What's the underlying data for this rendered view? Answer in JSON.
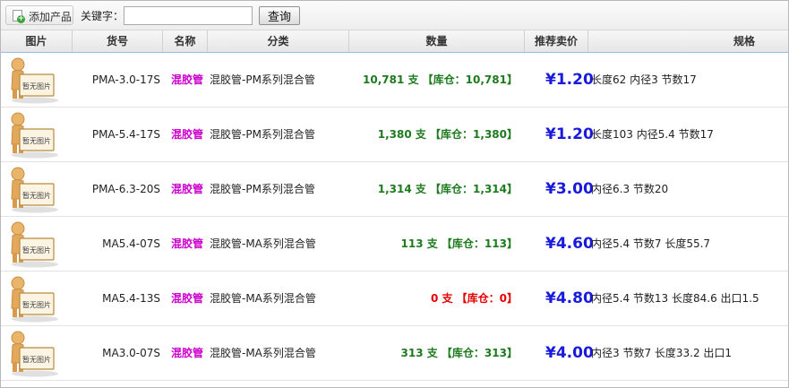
{
  "toolbar": {
    "add_label": "添加产品",
    "keyword_label": "关键字：",
    "keyword_value": "",
    "search_label": "查询"
  },
  "columns": {
    "image": "图片",
    "code": "货号",
    "name": "名称",
    "category": "分类",
    "quantity": "数量",
    "price": "推荐卖价",
    "spec": "规格"
  },
  "placeholder_image_text": "暂无图片",
  "colors": {
    "name": "#cc00cc",
    "qty_in_stock": "#1e7a1e",
    "qty_zero": "#e60000",
    "price": "#1a1adc",
    "header_border": "#99bbe8"
  },
  "rows": [
    {
      "code": "PMA-3.0-17S",
      "name": "混胶管",
      "category": "混胶管-PM系列混合管",
      "quantity": "10,781 支 【库仓：10,781】",
      "price": "¥1.20",
      "spec": "长度62 内径3 节数17",
      "in_stock": true
    },
    {
      "code": "PMA-5.4-17S",
      "name": "混胶管",
      "category": "混胶管-PM系列混合管",
      "quantity": "1,380 支 【库仓：1,380】",
      "price": "¥1.20",
      "spec": "长度103 内径5.4 节数17",
      "in_stock": true
    },
    {
      "code": "PMA-6.3-20S",
      "name": "混胶管",
      "category": "混胶管-PM系列混合管",
      "quantity": "1,314 支 【库仓：1,314】",
      "price": "¥3.00",
      "spec": "内径6.3 节数20",
      "in_stock": true
    },
    {
      "code": "MA5.4-07S",
      "name": "混胶管",
      "category": "混胶管-MA系列混合管",
      "quantity": "113 支 【库仓：113】",
      "price": "¥4.60",
      "spec": "内径5.4 节数7 长度55.7",
      "in_stock": true
    },
    {
      "code": "MA5.4-13S",
      "name": "混胶管",
      "category": "混胶管-MA系列混合管",
      "quantity": "0 支 【库仓：0】",
      "price": "¥4.80",
      "spec": "内径5.4 节数13 长度84.6 出口1.5",
      "in_stock": false
    },
    {
      "code": "MA3.0-07S",
      "name": "混胶管",
      "category": "混胶管-MA系列混合管",
      "quantity": "313 支 【库仓：313】",
      "price": "¥4.00",
      "spec": "内径3 节数7 长度33.2 出口1",
      "in_stock": true
    }
  ]
}
